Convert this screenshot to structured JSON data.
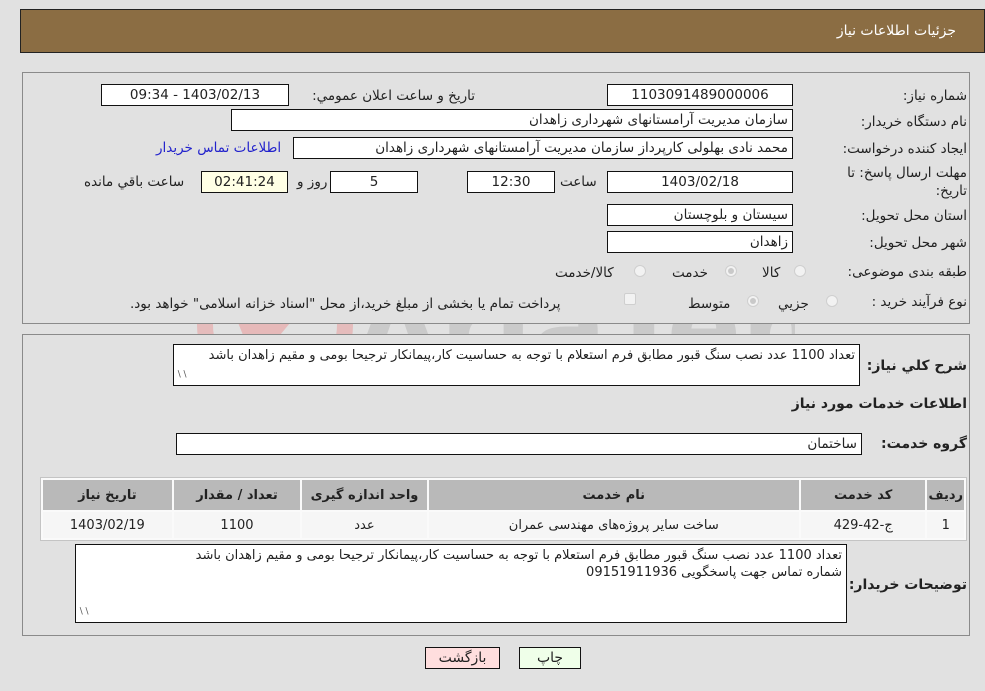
{
  "header": {
    "title": "جزئیات اطلاعات نیاز"
  },
  "details": {
    "need_number_label": "شماره نیاز:",
    "need_number": "1103091489000006",
    "announce_label": "تاریخ و ساعت اعلان عمومي:",
    "announce_value": "1403/02/13 - 09:34",
    "buyer_org_label": "نام دستگاه خریدار:",
    "buyer_org": "سازمان مدیریت آرامستانهای شهرداری زاهدان",
    "creator_label": "ایجاد کننده درخواست:",
    "creator": "محمد نادی بهلولی کارپرداز سازمان مدیریت آرامستانهای شهرداری زاهدان",
    "contact_link": "اطلاعات تماس خریدار",
    "deadline_label_line1": "مهلت ارسال پاسخ: تا",
    "deadline_label_line2": "تاریخ:",
    "deadline_date": "1403/02/18",
    "time_label": "ساعت",
    "deadline_time": "12:30",
    "days_value": "5",
    "days_label": "روز و",
    "remaining_time": "02:41:24",
    "remaining_label": "ساعت باقي مانده",
    "province_label": "استان محل تحویل:",
    "province": "سیستان و بلوچستان",
    "city_label": "شهر محل تحویل:",
    "city": "زاهدان",
    "category_label": "طبقه بندی موضوعی:",
    "category_options": [
      "کالا",
      "خدمت",
      "کالا/خدمت"
    ],
    "category_selected": "خدمت",
    "purchase_type_label": "نوع فرآیند خرید :",
    "purchase_type_options": [
      "جزيي",
      "متوسط"
    ],
    "purchase_type_selected": "متوسط",
    "treasury_note": "پرداخت تمام یا بخشی از مبلغ خرید،از محل \"اسناد خزانه اسلامی\" خواهد بود."
  },
  "description": {
    "label": "شرح كلي نياز:",
    "text": "تعداد 1100 عدد نصب سنگ قبور مطابق فرم استعلام  با توجه به حساسیت کار،پیمانکار ترجیحا بومی و مقیم زاهدان باشد"
  },
  "services": {
    "section_title": "اطلاعات خدمات مورد نیاز",
    "group_label": "گروه خدمت:",
    "group_value": "ساختمان",
    "columns": [
      "ردیف",
      "کد خدمت",
      "نام خدمت",
      "واحد اندازه گیری",
      "تعداد / مقدار",
      "تاریخ نیاز"
    ],
    "rows": [
      [
        "1",
        "ج-42-429",
        "ساخت سایر پروژه‌های مهندسی عمران",
        "عدد",
        "1100",
        "1403/02/19"
      ]
    ]
  },
  "buyer_notes": {
    "label": "توضیحات خریدار:",
    "line1": "تعداد 1100 عدد نصب سنگ قبور مطابق فرم استعلام  با توجه به حساسیت کار،پیمانکار ترجیحا بومی و مقیم زاهدان باشد",
    "line2": "شماره تماس جهت پاسخگویی 09151911936"
  },
  "buttons": {
    "print": "چاپ",
    "back": "بازگشت"
  },
  "watermark": {
    "text": "AriaTender.neT"
  }
}
